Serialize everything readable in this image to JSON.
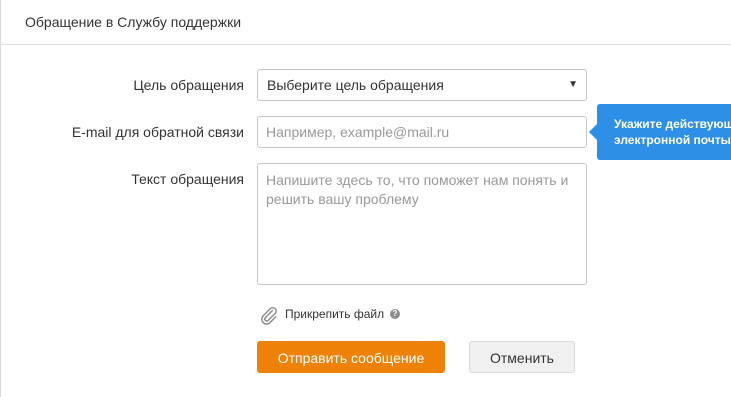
{
  "dialog": {
    "title": "Обращение в Службу поддержки"
  },
  "form": {
    "purpose": {
      "label": "Цель обращения",
      "selected": "Выберите цель обращения"
    },
    "email": {
      "label": "E-mail для обратной связи",
      "placeholder": "Например, example@mail.ru",
      "value": ""
    },
    "message": {
      "label": "Текст обращения",
      "placeholder": "Напишите здесь то, что поможет нам понять и решить вашу проблему",
      "value": ""
    },
    "attach": {
      "label": "Прикрепить файл",
      "help": "?"
    }
  },
  "tooltip": {
    "text": "Укажите действующий адрес\nэлектронной почты"
  },
  "buttons": {
    "send_label": "Отправить сообщение",
    "cancel_label": "Отменить"
  },
  "colors": {
    "accent": "#ee8208",
    "tooltip": "#2d8fe6"
  },
  "icons": {
    "select_arrow": "chevron-down-icon",
    "attach": "paperclip-icon",
    "help": "question-icon"
  }
}
